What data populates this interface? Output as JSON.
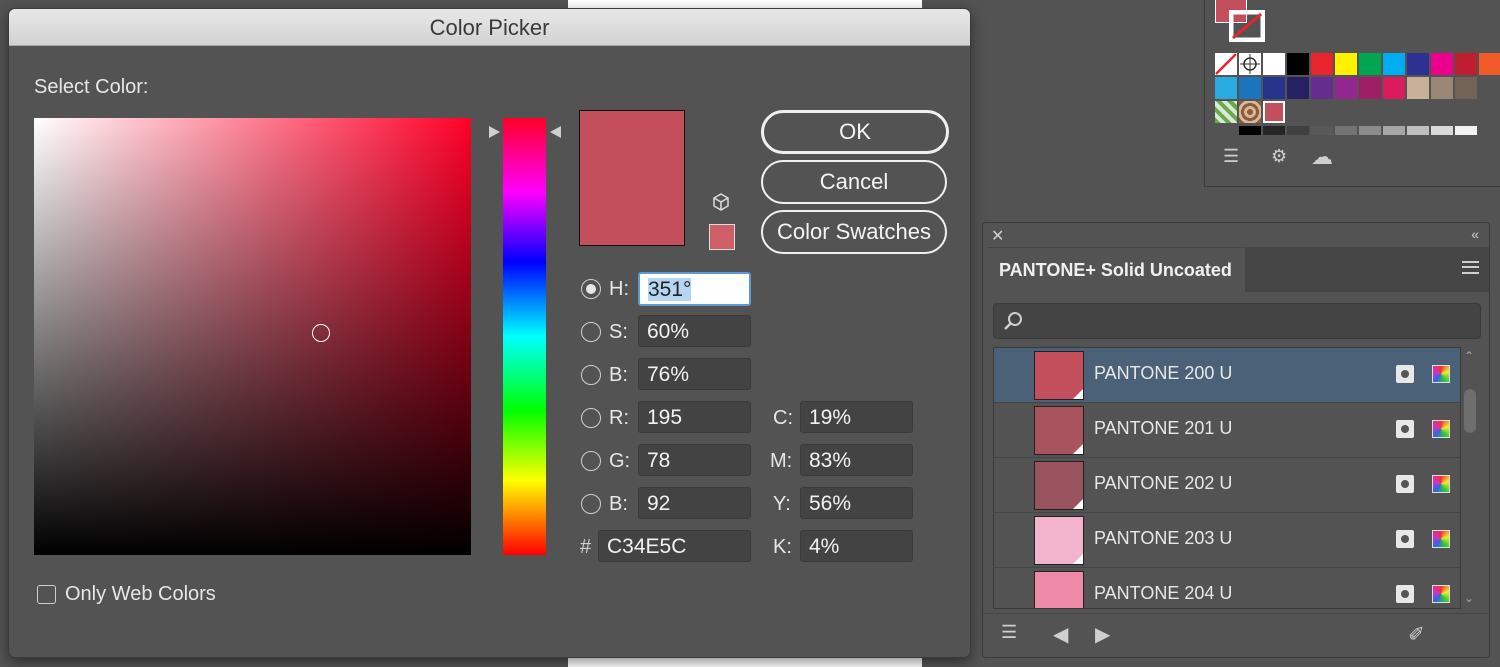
{
  "dialog": {
    "title": "Color Picker",
    "select_color_label": "Select Color:",
    "only_web_colors_label": "Only Web Colors",
    "only_web_colors_checked": false,
    "buttons": {
      "ok": "OK",
      "cancel": "Cancel",
      "color_swatches": "Color Swatches"
    },
    "current_color": "#C34E5C",
    "web_safe_swatch_color": "#CF5F66",
    "hsb": {
      "h": {
        "label": "H:",
        "value": "351°",
        "selected": true
      },
      "s": {
        "label": "S:",
        "value": "60%",
        "selected": false
      },
      "b": {
        "label": "B:",
        "value": "76%",
        "selected": false
      }
    },
    "rgb": {
      "r": {
        "label": "R:",
        "value": "195"
      },
      "g": {
        "label": "G:",
        "value": "78"
      },
      "b": {
        "label": "B:",
        "value": "92"
      }
    },
    "cmyk": {
      "c": {
        "label": "C:",
        "value": "19%"
      },
      "m": {
        "label": "M:",
        "value": "83%"
      },
      "y": {
        "label": "Y:",
        "value": "56%"
      },
      "k": {
        "label": "K:",
        "value": "4%"
      }
    },
    "hex": {
      "label": "#",
      "value": "C34E5C"
    }
  },
  "swatches_panel": {
    "fill_color": "#C34E5C",
    "icons": [
      "swatch-libraries-icon",
      "show-kinds-icon",
      "cc-libraries-icon"
    ],
    "row1": [
      "#ffffff",
      "#000000",
      "#e8242c",
      "#fff200",
      "#00a651",
      "#00aeef",
      "#2e3192",
      "#ec008c",
      "#be1e2d",
      "#f15a29"
    ],
    "row2": [
      "#29abe2",
      "#1b75bc",
      "#27348b",
      "#262262",
      "#662d91",
      "#92278f",
      "#9e1f63",
      "#da1c5c",
      "#c7b299",
      "#998675",
      "#736357"
    ],
    "grays": [
      "#000000",
      "#262626",
      "#404040",
      "#595959",
      "#737373",
      "#8c8c8c",
      "#a6a6a6",
      "#bfbfbf",
      "#d9d9d9",
      "#f2f2f2"
    ]
  },
  "pantone_panel": {
    "tab_label": "PANTONE+ Solid Uncoated",
    "search_placeholder": "",
    "items": [
      {
        "name": "PANTONE 200 U",
        "color": "#c34e5c",
        "selected": true
      },
      {
        "name": "PANTONE 201 U",
        "color": "#a9535f",
        "selected": false
      },
      {
        "name": "PANTONE 202 U",
        "color": "#98535e",
        "selected": false
      },
      {
        "name": "PANTONE 203 U",
        "color": "#f2b3cc",
        "selected": false
      },
      {
        "name": "PANTONE 204 U",
        "color": "#ee8aa8",
        "selected": false
      }
    ]
  }
}
